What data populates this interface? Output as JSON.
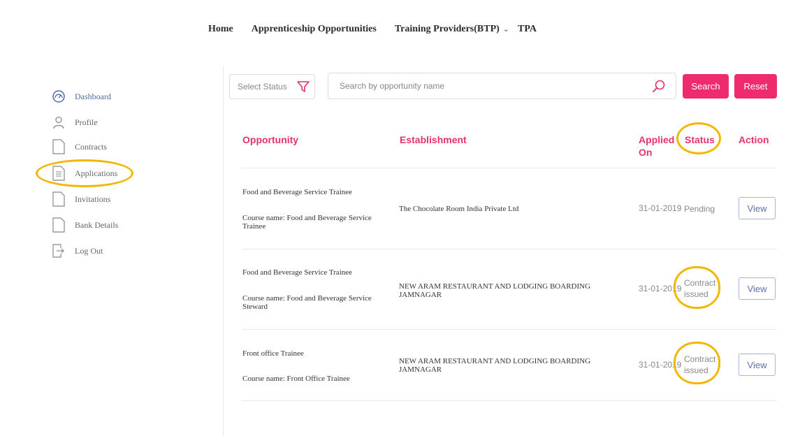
{
  "nav": {
    "home": "Home",
    "apprenticeship": "Apprenticeship Opportunities",
    "training": "Training Providers(BTP)",
    "tpa": "TPA"
  },
  "sidebar": {
    "items": [
      {
        "label": "Dashboard",
        "icon": "dashboard-icon"
      },
      {
        "label": "Profile",
        "icon": "user-icon"
      },
      {
        "label": "Contracts",
        "icon": "document-icon"
      },
      {
        "label": "Applications",
        "icon": "document-lines-icon"
      },
      {
        "label": "Invitations",
        "icon": "document-icon"
      },
      {
        "label": "Bank Details",
        "icon": "document-icon"
      },
      {
        "label": "Log Out",
        "icon": "logout-icon"
      }
    ]
  },
  "filters": {
    "status_label": "Select Status",
    "search_placeholder": "Search by opportunity name",
    "search_button": "Search",
    "reset_button": "Reset"
  },
  "table": {
    "headers": {
      "opportunity": "Opportunity",
      "establishment": "Establishment",
      "applied_on_1": "Applied",
      "applied_on_2": "On",
      "status": "Status",
      "action": "Action"
    },
    "rows": [
      {
        "opportunity": "Food and Beverage Service Trainee",
        "course_1": "Course name: Food and Beverage Service",
        "course_2": "Trainee",
        "establishment_1": "The Chocolate Room India Private Ltd",
        "establishment_2": "",
        "applied_on": "31-01-2019",
        "status_1": "Pending",
        "status_2": "",
        "action": "View"
      },
      {
        "opportunity": "Food and Beverage Service Trainee",
        "course_1": "Course name: Food and Beverage Service",
        "course_2": "Steward",
        "establishment_1": "NEW ARAM RESTAURANT AND LODGING BOARDING",
        "establishment_2": "JAMNAGAR",
        "applied_on": "31-01-2019",
        "status_1": "Contract",
        "status_2": "issued",
        "action": "View"
      },
      {
        "opportunity": "Front office Trainee",
        "course_1": "Course name: Front Office Trainee",
        "course_2": "",
        "establishment_1": "NEW ARAM RESTAURANT AND LODGING BOARDING",
        "establishment_2": "JAMNAGAR",
        "applied_on": "31-01-2019",
        "status_1": "Contract",
        "status_2": "issued",
        "action": "View"
      }
    ]
  },
  "colors": {
    "accent": "#ee2b6e",
    "header_text": "#e8316f",
    "annotation": "#f2b705",
    "active_nav": "#4c6aa8"
  }
}
